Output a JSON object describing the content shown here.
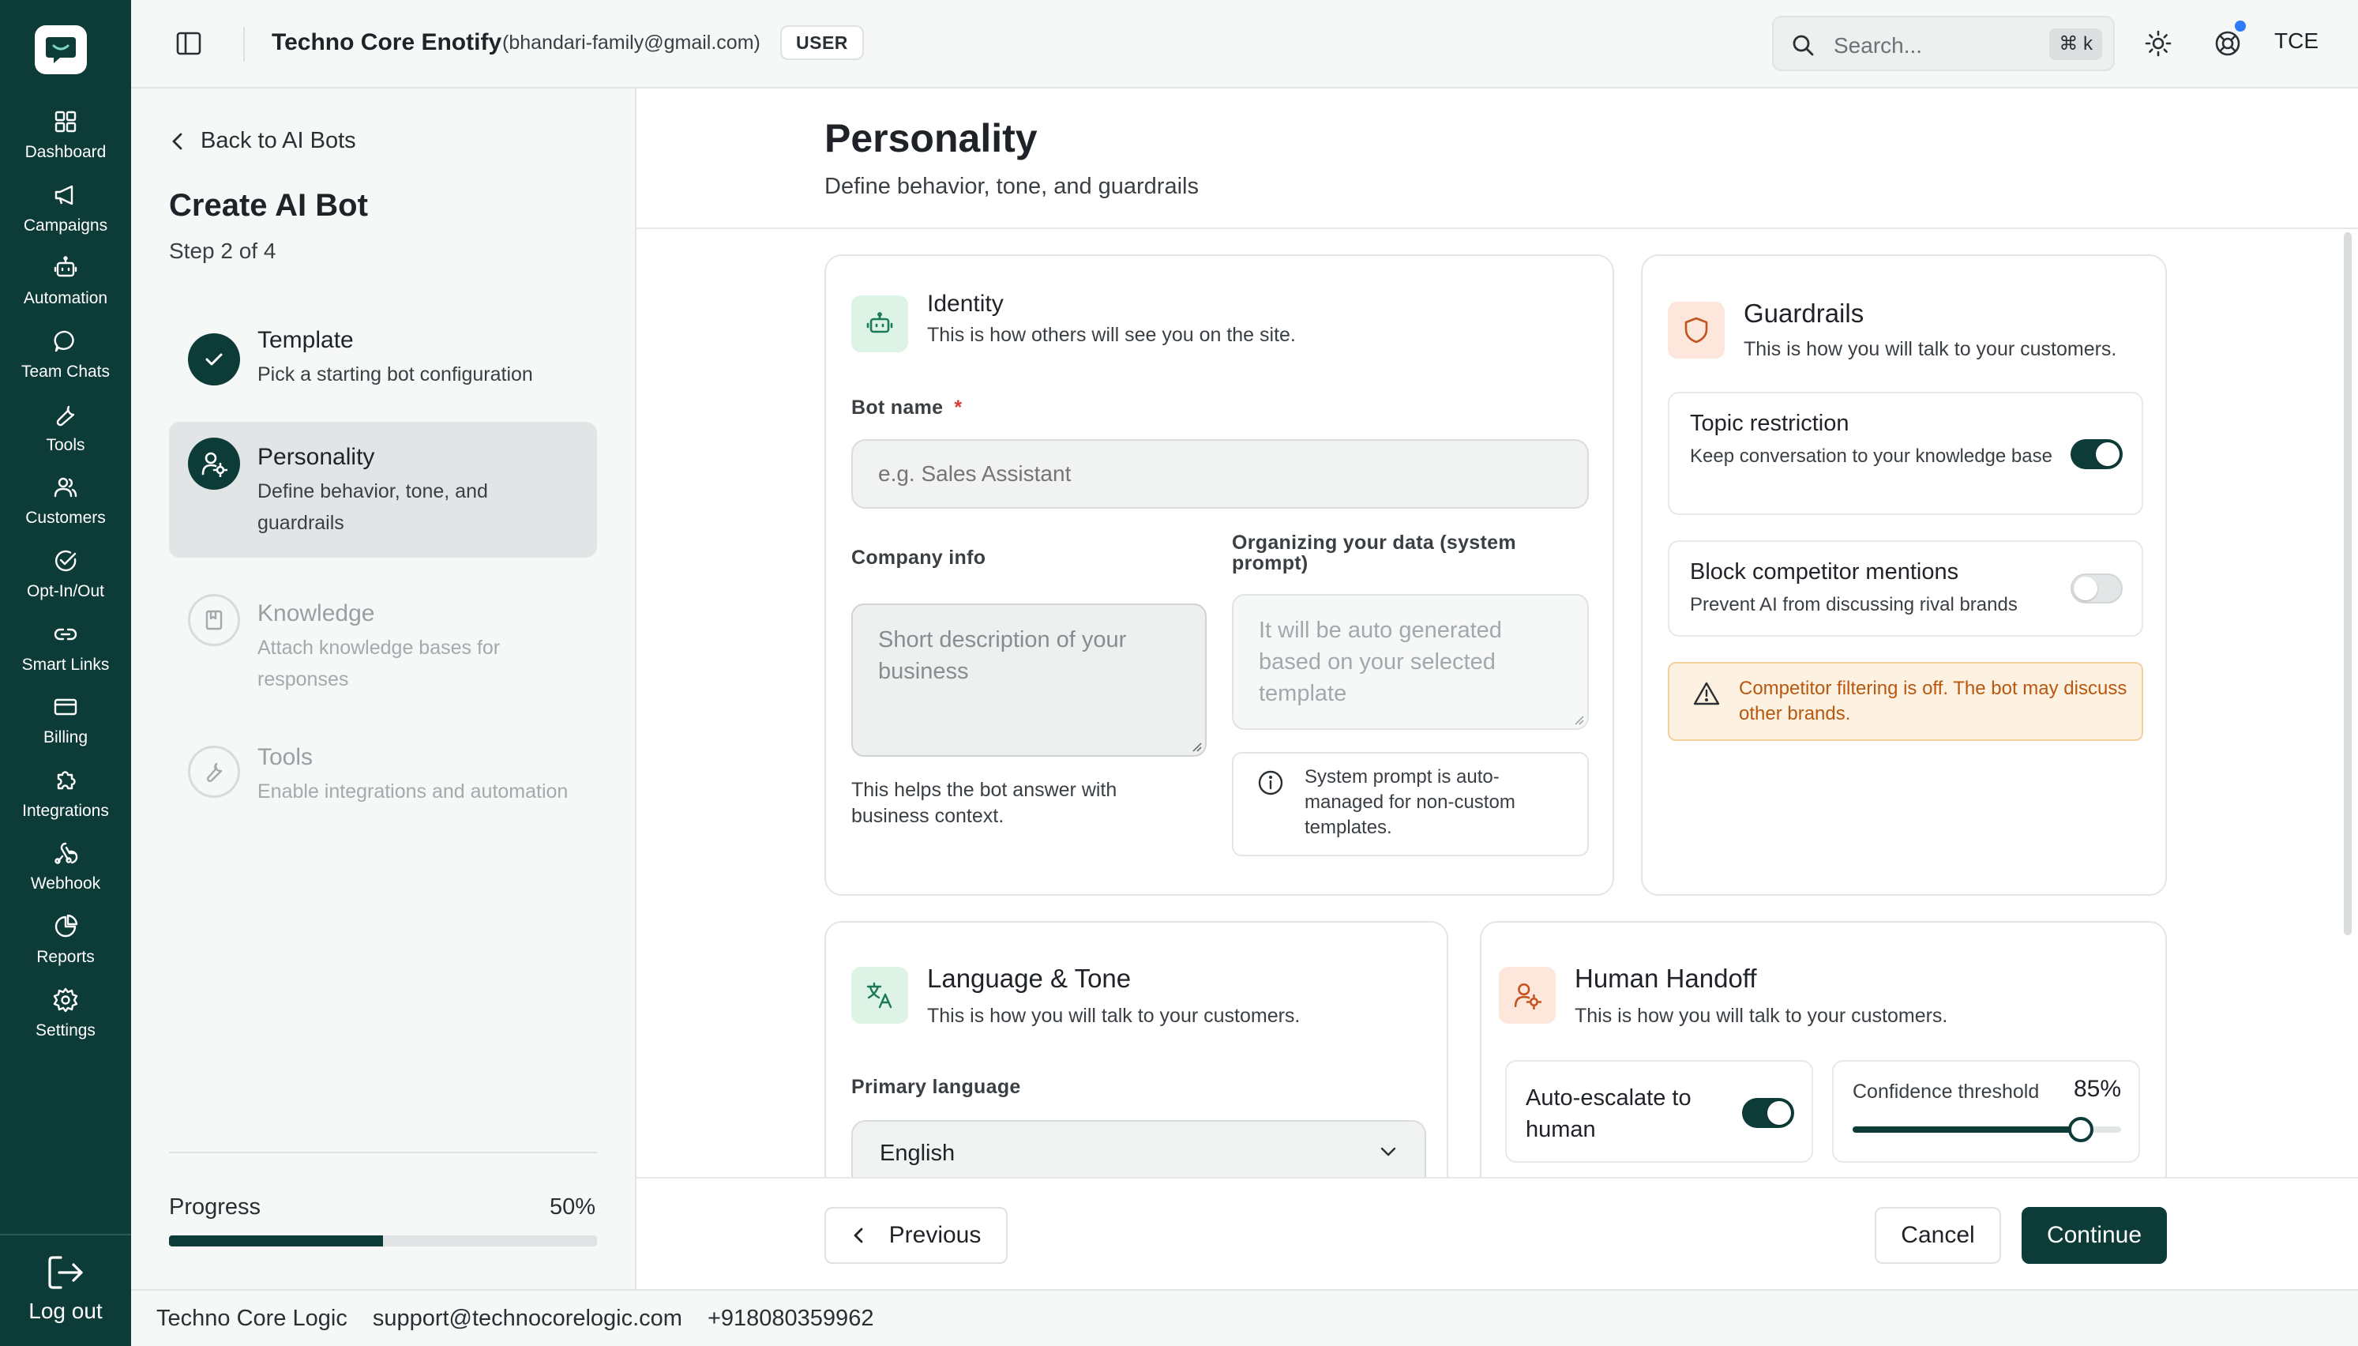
{
  "app": {
    "workspace_title": "Techno Core Enotify",
    "account_email": "(bhandari-family@gmail.com)",
    "role_badge": "USER",
    "search_placeholder": "Search...",
    "search_shortcut": "⌘ k",
    "avatar_initials": "TCE"
  },
  "nav": {
    "items": [
      {
        "label": "Dashboard",
        "icon": "dashboard-icon"
      },
      {
        "label": "Campaigns",
        "icon": "megaphone-icon"
      },
      {
        "label": "Automation",
        "icon": "bot-icon"
      },
      {
        "label": "Team Chats",
        "icon": "chat-icon"
      },
      {
        "label": "Tools",
        "icon": "wrench-icon"
      },
      {
        "label": "Customers",
        "icon": "users-icon"
      },
      {
        "label": "Opt-In/Out",
        "icon": "check-circle-icon"
      },
      {
        "label": "Smart Links",
        "icon": "link-icon"
      },
      {
        "label": "Billing",
        "icon": "credit-card-icon"
      },
      {
        "label": "Integrations",
        "icon": "puzzle-icon"
      },
      {
        "label": "Webhook",
        "icon": "webhook-icon"
      },
      {
        "label": "Reports",
        "icon": "pie-chart-icon"
      },
      {
        "label": "Settings",
        "icon": "gear-icon"
      }
    ],
    "logout_label": "Log out"
  },
  "wizard": {
    "back_label": "Back to AI Bots",
    "title": "Create AI Bot",
    "step_indicator": "Step 2 of 4",
    "steps": [
      {
        "title": "Template",
        "description": "Pick a starting bot configuration",
        "state": "done"
      },
      {
        "title": "Personality",
        "description": "Define behavior, tone, and guardrails",
        "state": "current"
      },
      {
        "title": "Knowledge",
        "description": "Attach knowledge bases for responses",
        "state": "upcoming"
      },
      {
        "title": "Tools",
        "description": "Enable integrations and automation",
        "state": "upcoming"
      }
    ],
    "progress_label": "Progress",
    "progress_value": "50%",
    "progress_fraction": 0.5
  },
  "page": {
    "title": "Personality",
    "subtitle": "Define behavior, tone, and guardrails"
  },
  "identity": {
    "title": "Identity",
    "subtitle": "This is how others will see you on the site.",
    "bot_name_label": "Bot name",
    "bot_name_required_mark": "*",
    "bot_name_placeholder": "e.g. Sales Assistant",
    "company_info_label": "Company info",
    "company_info_placeholder": "Short description of your business",
    "company_info_helper": "This helps the bot answer with business context.",
    "system_prompt_label": "Organizing your data (system prompt)",
    "system_prompt_placeholder": "It will be auto generated based on your selected template",
    "system_prompt_note": "System prompt is auto-managed for non-custom templates."
  },
  "guardrails": {
    "title": "Guardrails",
    "subtitle": "This is how you will talk to your customers.",
    "options": [
      {
        "title": "Topic restriction",
        "description": "Keep conversation to your knowledge base",
        "enabled": true
      },
      {
        "title": "Block competitor mentions",
        "description": "Prevent AI from discussing rival brands",
        "enabled": false
      }
    ],
    "warning": "Competitor filtering is off. The bot may discuss other brands."
  },
  "language_tone": {
    "title": "Language & Tone",
    "subtitle": "This is how you will talk to your customers.",
    "primary_language_label": "Primary language",
    "primary_language_value": "English"
  },
  "handoff": {
    "title": "Human Handoff",
    "subtitle": "This is how you will talk to your customers.",
    "auto_escalate_label": "Auto-escalate to human",
    "auto_escalate_enabled": true,
    "confidence_label": "Confidence threshold",
    "confidence_value": "85%",
    "confidence_fraction": 0.85
  },
  "actions": {
    "previous_label": "Previous",
    "cancel_label": "Cancel",
    "continue_label": "Continue"
  },
  "footer": {
    "company": "Techno Core Logic",
    "email": "support@technocorelogic.com",
    "phone": "+918080359962"
  },
  "colors": {
    "brand": "#0d3b38",
    "accent_green_bg": "#dcf3e6",
    "accent_peach_bg": "#fde6dc",
    "warning_text": "#b8570f",
    "required": "#d93b3b"
  }
}
